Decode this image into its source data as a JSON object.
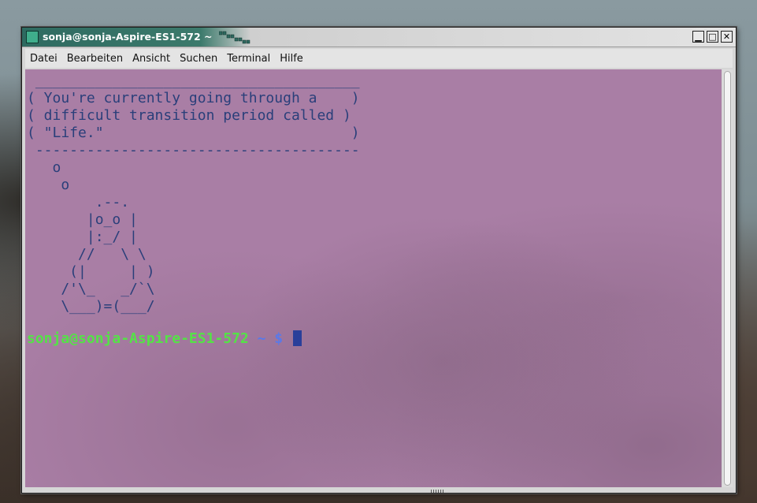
{
  "window": {
    "title": "sonja@sonja-Aspire-ES1-572 ~",
    "buttons": {
      "minimize": "▁",
      "maximize": "□",
      "close": "✕"
    }
  },
  "menubar": {
    "items": [
      "Datei",
      "Bearbeiten",
      "Ansicht",
      "Suchen",
      "Terminal",
      "Hilfe"
    ]
  },
  "terminal": {
    "output": " ______________________________________\n( You're currently going through a    )\n( difficult transition period called )\n( \"Life.\"                             )\n --------------------------------------\n   o\n    o\n        .--.\n       |o_o |\n       |:_/ |\n      //   \\ \\\n     (|     | )\n    /'\\_   _/`\\\n    \\___)=(___/",
    "prompt": {
      "user_host": "sonja@sonja-Aspire-ES1-572",
      "path": "~",
      "symbol": "$"
    }
  },
  "colors": {
    "terminal_bg": "#a97ea5",
    "text": "#2a3f7a",
    "prompt_user": "#54e346",
    "prompt_path": "#5a79e8"
  },
  "icons": {
    "window_icon": "terminal-window-icon",
    "title_grip": "titlebar-grip-icon"
  }
}
